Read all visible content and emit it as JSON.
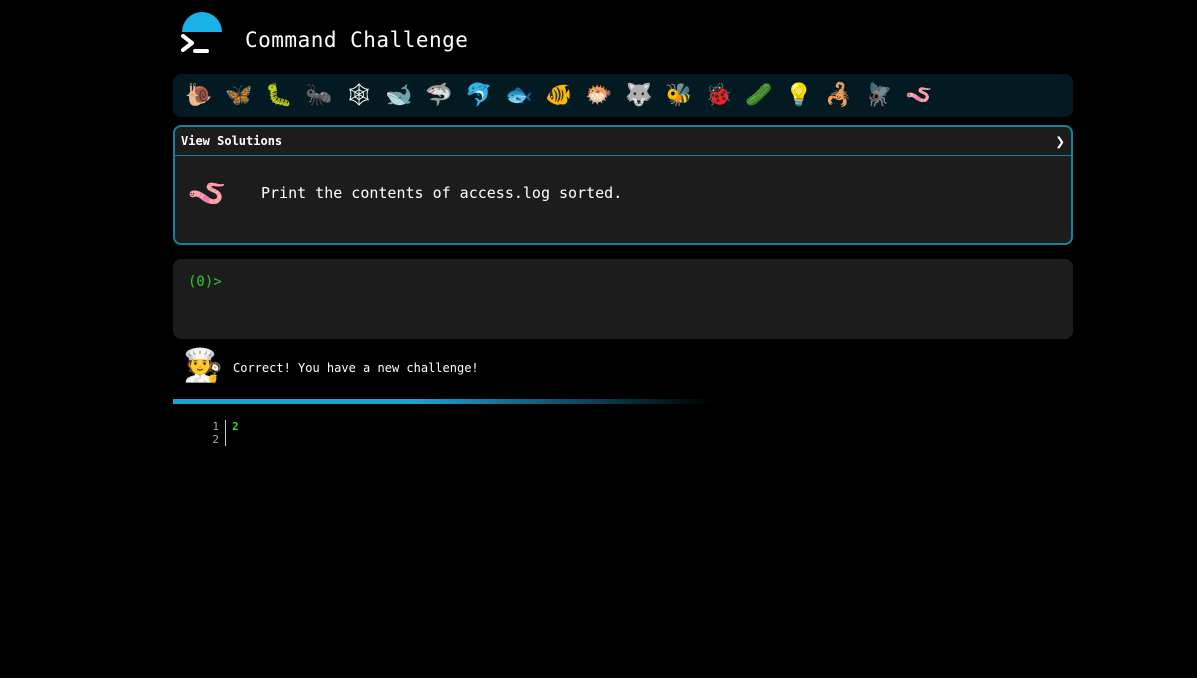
{
  "header": {
    "title": "Command Challenge",
    "logo_icon": "terminal-umbrella-icon"
  },
  "challenges": [
    {
      "name": "snail",
      "glyph": "🐌"
    },
    {
      "name": "butterfly",
      "glyph": "🦋"
    },
    {
      "name": "caterpillar",
      "glyph": "🐛"
    },
    {
      "name": "ant",
      "glyph": "🐜"
    },
    {
      "name": "spider-web",
      "glyph": "🕸"
    },
    {
      "name": "whale",
      "glyph": "🐋"
    },
    {
      "name": "shark",
      "glyph": "🦈"
    },
    {
      "name": "dolphin",
      "glyph": "🐬"
    },
    {
      "name": "fish",
      "glyph": "🐟"
    },
    {
      "name": "tropical-fish",
      "glyph": "🐠"
    },
    {
      "name": "blowfish",
      "glyph": "🐡"
    },
    {
      "name": "wolf",
      "glyph": "🐺"
    },
    {
      "name": "bee",
      "glyph": "🐝"
    },
    {
      "name": "ladybug",
      "glyph": "🐞"
    },
    {
      "name": "cucumber",
      "glyph": "🥒"
    },
    {
      "name": "bulb",
      "glyph": "💡"
    },
    {
      "name": "scorpion",
      "glyph": "🦂"
    },
    {
      "name": "fly",
      "glyph": "🪰"
    },
    {
      "name": "worm",
      "glyph": "🪱"
    }
  ],
  "solution": {
    "title": "View Solutions",
    "chevron": "❯",
    "task_icon": "worm-icon",
    "task_glyph": "🪱",
    "task_text": "Print the contents of access.log sorted."
  },
  "terminal": {
    "prompt": "(0)>",
    "input_value": ""
  },
  "feedback": {
    "glyph": "🧑‍🍳",
    "text": "Correct! You have a new challenge!",
    "progress": 0.6
  },
  "output": {
    "line_numbers": [
      "1",
      "2"
    ],
    "lines": [
      "2",
      ""
    ]
  },
  "colors": {
    "accent": "#1ab0e8",
    "prompt_green": "#2ec82e",
    "border": "#1a7fa0"
  }
}
